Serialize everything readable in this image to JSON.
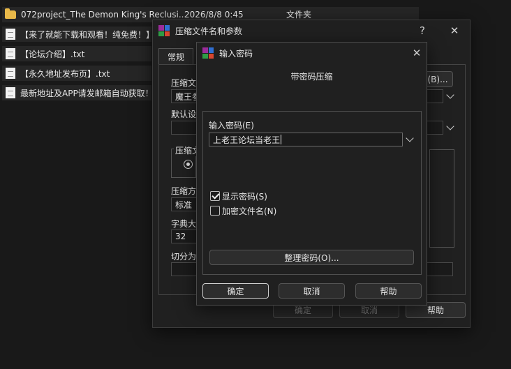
{
  "file_list": {
    "rows": [
      {
        "name": "072project_The Demon King's Reclusi...",
        "date": "2026/8/8 0:45",
        "type": "文件夹",
        "icon": "folder-icon"
      },
      {
        "name": "【来了就能下载和观看！纯免费！】",
        "icon": "document-icon"
      },
      {
        "name": "【论坛介绍】.txt",
        "icon": "document-icon"
      },
      {
        "name": "【永久地址发布页】.txt",
        "icon": "document-icon"
      },
      {
        "name": "最新地址及APP请发邮箱自动获取！",
        "icon": "document-icon"
      }
    ]
  },
  "archive_dialog": {
    "title": "压缩文件名和参数",
    "help_glyph": "?",
    "close_glyph": "✕",
    "tab_general": "常规",
    "label_archive_name": "压缩文",
    "archive_name_value": "魔王参",
    "browse_button": "(B)...",
    "label_default_profile": "默认设",
    "label_archive_format": "压缩文",
    "label_method": "压缩方",
    "method_value": "标准",
    "label_dict": "字典大",
    "dict_value": "32",
    "label_split": "切分为",
    "ok_button": "确定",
    "cancel_button": "取消",
    "help_button": "帮助"
  },
  "password_dialog": {
    "title": "输入密码",
    "close_glyph": "✕",
    "heading": "带密码压缩",
    "label_password": "输入密码(E)",
    "password_value": "上老王论坛当老王",
    "show_password_label": "显示密码(S)",
    "show_password_checked": true,
    "encrypt_names_label": "加密文件名(N)",
    "encrypt_names_checked": false,
    "organize_button": "整理密码(O)...",
    "ok_button": "确定",
    "cancel_button": "取消",
    "help_button": "帮助"
  },
  "colors": {
    "background": "#191919",
    "dialog_bg": "#202020",
    "folder": "#e9b949"
  }
}
